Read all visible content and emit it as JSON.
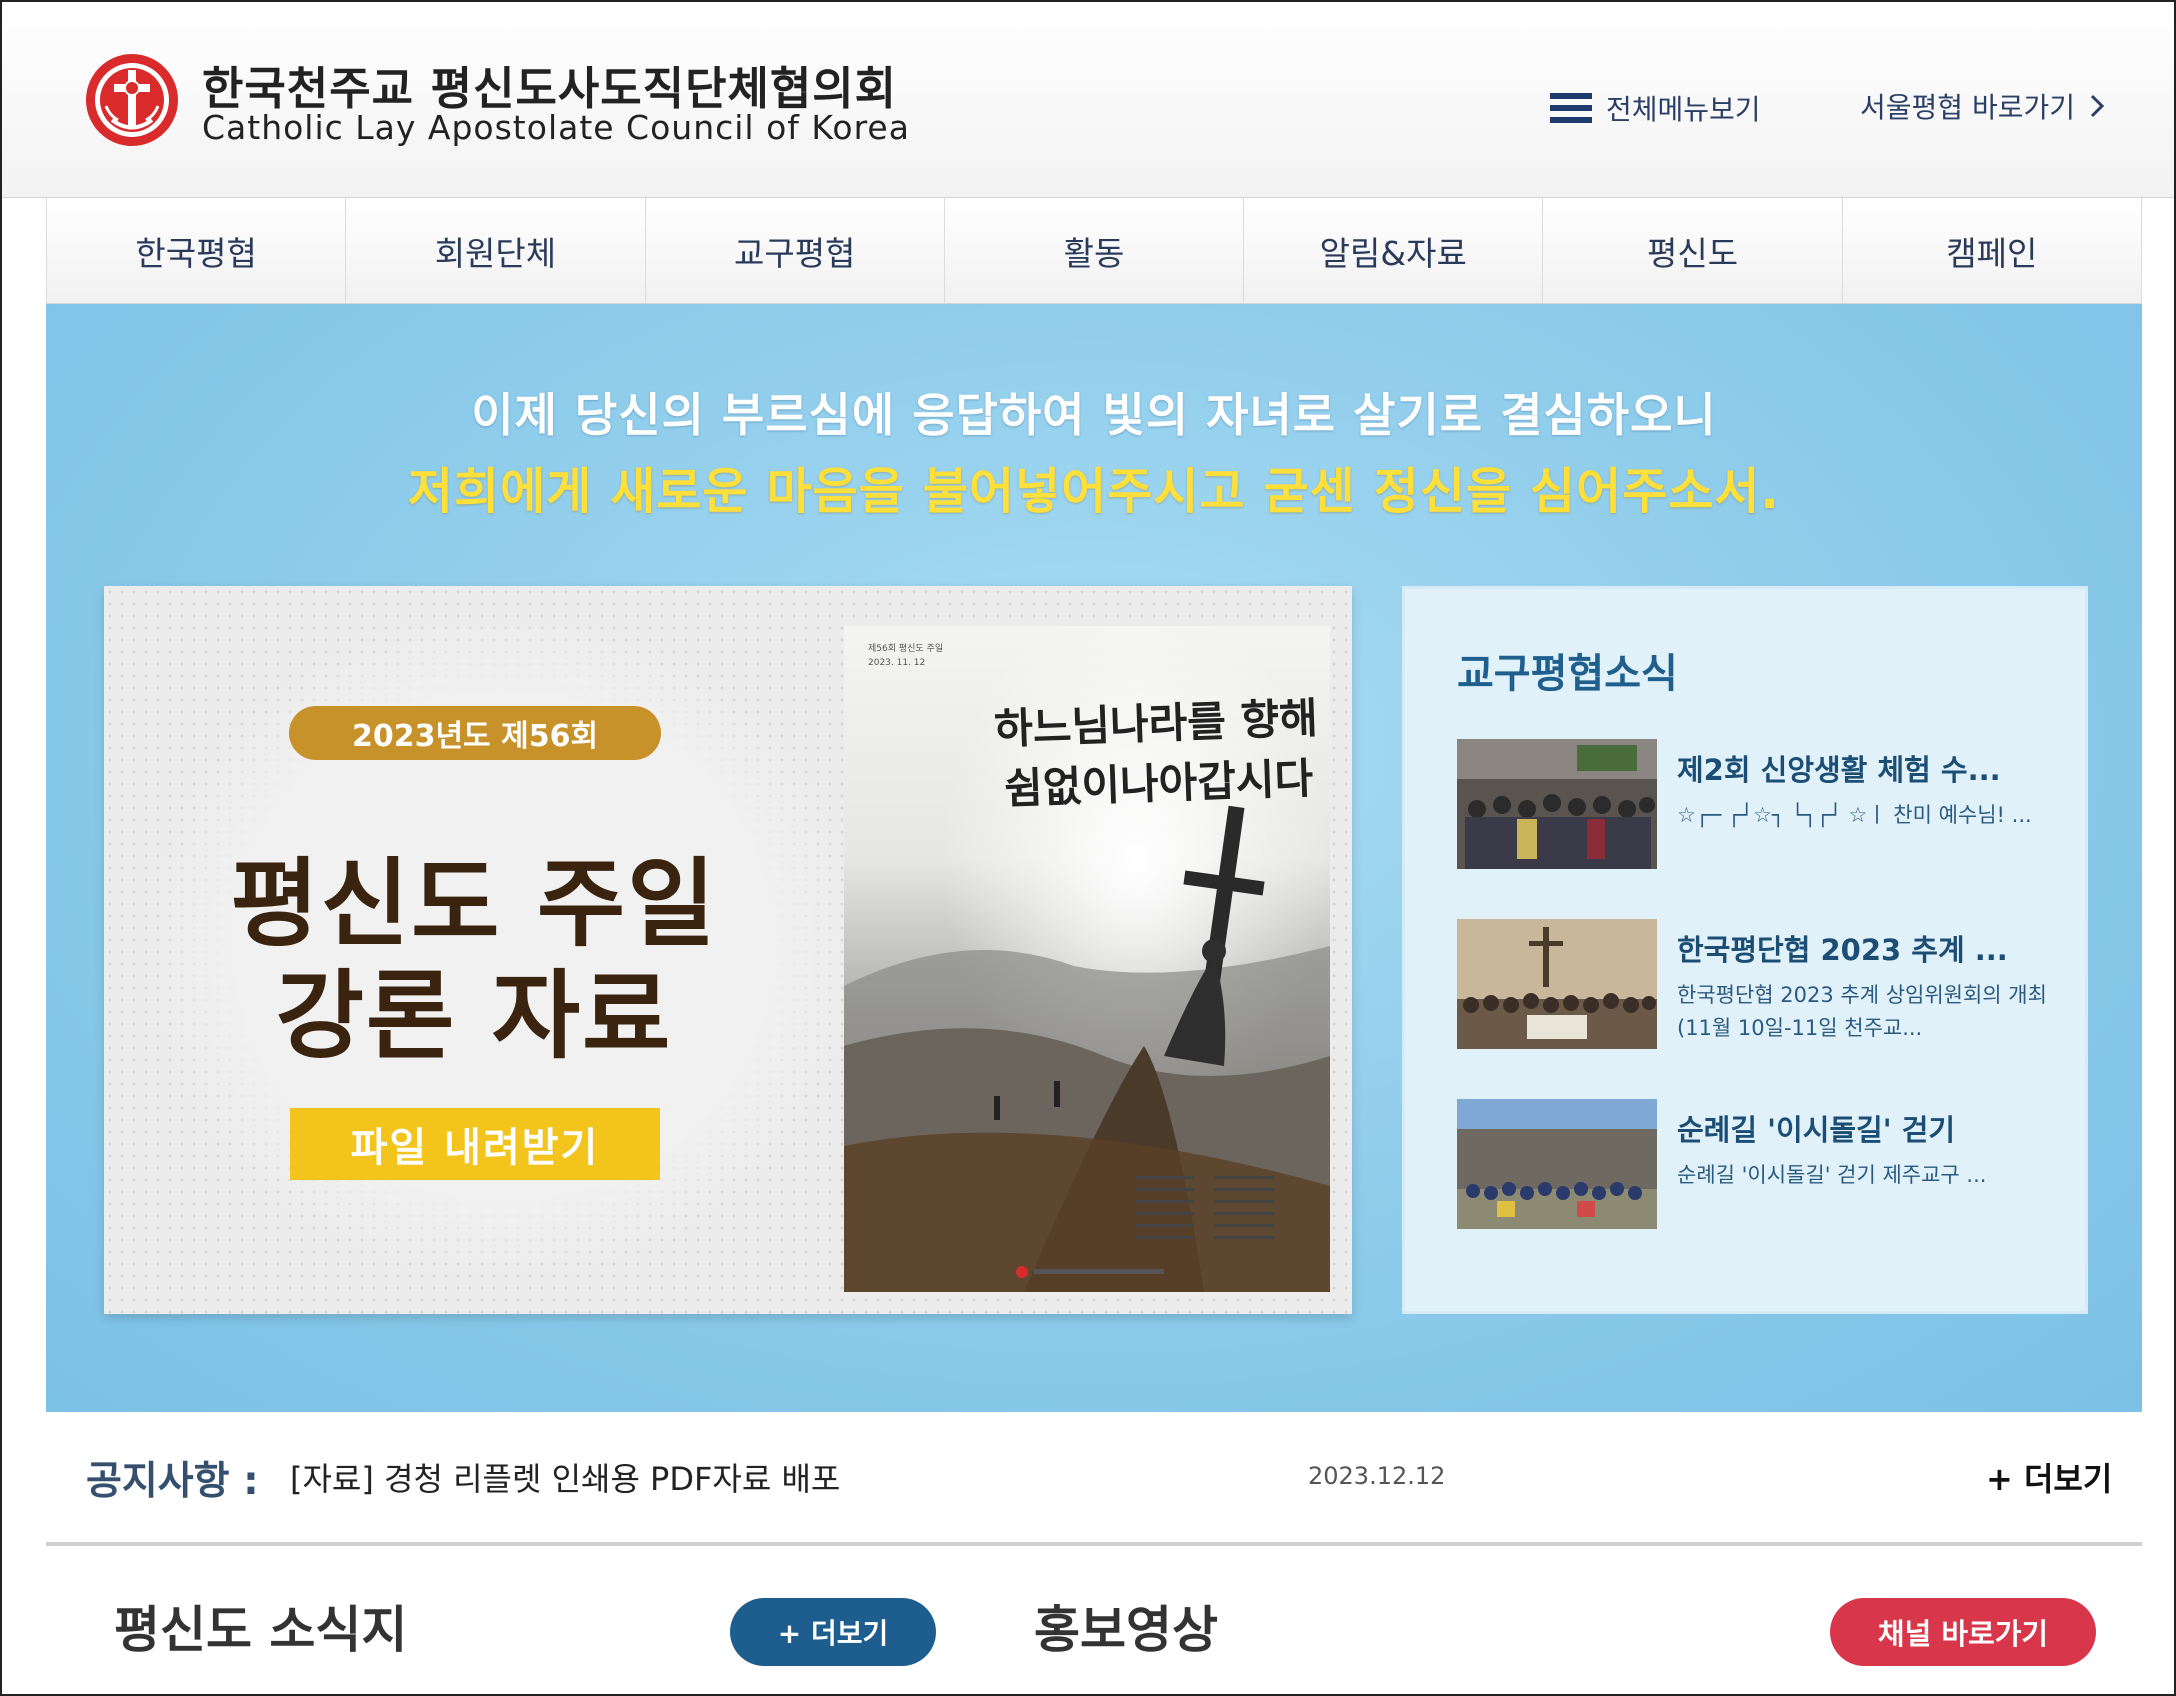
{
  "header": {
    "org_name_ko": "한국천주교 평신도사도직단체협의회",
    "org_name_en": "Catholic Lay Apostolate Council of Korea",
    "all_menu_label": "전체메뉴보기",
    "seoul_link_label": "서울평협 바로가기",
    "logo_icon": "cross-seal-icon",
    "menu_icon": "hamburger-icon",
    "chevron_icon": "chevron-right-icon"
  },
  "nav": {
    "items": [
      "한국평협",
      "회원단체",
      "교구평협",
      "활동",
      "알림&자료",
      "평신도",
      "캠페인"
    ]
  },
  "hero": {
    "line1": "이제 당신의 부르심에 응답하여 빛의 자녀로 살기로 결심하오니",
    "line2": "저희에게 새로운 마음을 불어넣어주시고 굳센 정신을 심어주소서."
  },
  "banner": {
    "pill": "2023년도 제56회",
    "title_line1": "평신도 주일",
    "title_line2": "강론 자료",
    "download_label": "파일 내려받기",
    "poster_small": "제56회 평신도 주일\n2023. 11. 12",
    "poster_callig1": "하느님나라를 향해",
    "poster_callig2": "쉼없이나아갑시다"
  },
  "news": {
    "title": "교구평협소식",
    "items": [
      {
        "headline": "제2회 신앙생활 체험 수...",
        "desc": "☆┌─ ┌┘☆┐ └┐┌┘ ☆ㅣ 찬미 예수님! ..."
      },
      {
        "headline": "한국평단협 2023 추계 ...",
        "desc": "한국평단협 2023 추계 상임위원회의 개최(11월 10일-11일 천주교..."
      },
      {
        "headline": "순례길 '이시돌길' 걷기",
        "desc": "순례길 '이시돌길' 걷기     제주교구 ..."
      }
    ]
  },
  "notice": {
    "label": "공지사항 :",
    "text": "[자료] 경청 리플렛 인쇄용 PDF자료 배포",
    "date": "2023.12.12",
    "more_label": "+ 더보기"
  },
  "bottom": {
    "news_title": "평신도 소식지",
    "news_more_label": "+ 더보기",
    "video_title": "홍보영상",
    "video_button_label": "채널 바로가기"
  },
  "colors": {
    "hero_bg": "#8ccbea",
    "hero_highlight": "#ffe03a",
    "brand_red": "#d8364a",
    "brand_navy": "#1d5e8e",
    "pill_gold": "#c8922a",
    "download_yellow": "#f2c41c"
  }
}
